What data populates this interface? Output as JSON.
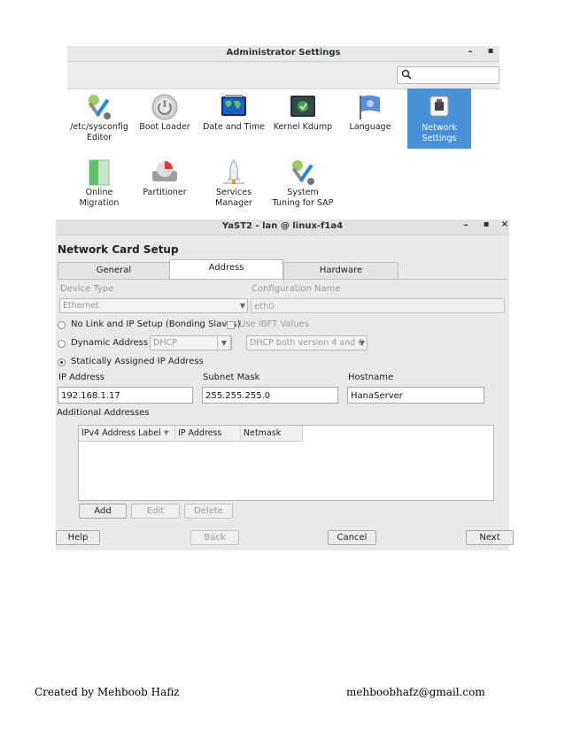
{
  "admin": {
    "title": "Administrator Settings",
    "minimize": "–",
    "maximize": "▪",
    "tiles": [
      {
        "label": "/etc/sysconfig\nEditor",
        "icon": "sysconfig-tools-icon"
      },
      {
        "label": "Boot Loader",
        "icon": "power-icon"
      },
      {
        "label": "Date and Time",
        "icon": "world-map-clock-icon"
      },
      {
        "label": "Kernel Kdump",
        "icon": "kernel-monitor-icon"
      },
      {
        "label": "Language",
        "icon": "flag-icon"
      },
      {
        "label": "Network\nSettings",
        "icon": "network-lock-icon",
        "selected": true
      },
      {
        "label": "Online\nMigration",
        "icon": "migration-icon"
      },
      {
        "label": "Partitioner",
        "icon": "disk-pie-icon"
      },
      {
        "label": "Services\nManager",
        "icon": "rocket-icon"
      },
      {
        "label": "System\nTuning for SAP",
        "icon": "tuning-tools-icon"
      }
    ]
  },
  "yast": {
    "title": "YaST2 - lan @ linux-f1a4",
    "minimize": "–",
    "maximize": "▪",
    "close": "×",
    "heading": "Network Card Setup",
    "tabs": [
      {
        "label": "General"
      },
      {
        "label": "Address",
        "active": true
      },
      {
        "label": "Hardware"
      }
    ],
    "device_type_label": "Device Type",
    "device_type_value": "Ethernet",
    "config_name_label": "Configuration Name",
    "config_name_value": "eth0",
    "radio_no_link": "No Link and IP Setup (Bonding Slaves)",
    "check_ibft": "Use iBFT Values",
    "radio_dynamic": "Dynamic Address",
    "dynamic_combo": "DHCP",
    "dhcp_version_combo": "DHCP both version 4 and 6",
    "radio_static": "Statically Assigned IP Address",
    "ip_label": "IP Address",
    "ip_value": "192.168.1.17",
    "subnet_label": "Subnet Mask",
    "subnet_value": "255.255.255.0",
    "hostname_label": "Hostname",
    "hostname_value": "HanaServer",
    "additional_label": "Additional Addresses",
    "table_headers": [
      "IPv4 Address Label",
      "IP Address",
      "Netmask"
    ],
    "btn_add": "Add",
    "btn_edit": "Edit",
    "btn_delete": "Delete",
    "btn_help": "Help",
    "btn_back": "Back",
    "btn_cancel": "Cancel",
    "btn_next": "Next"
  },
  "footer": {
    "created_by": "Created by Mehboob Hafiz",
    "email": "mehboobhafz@gmail.com"
  }
}
